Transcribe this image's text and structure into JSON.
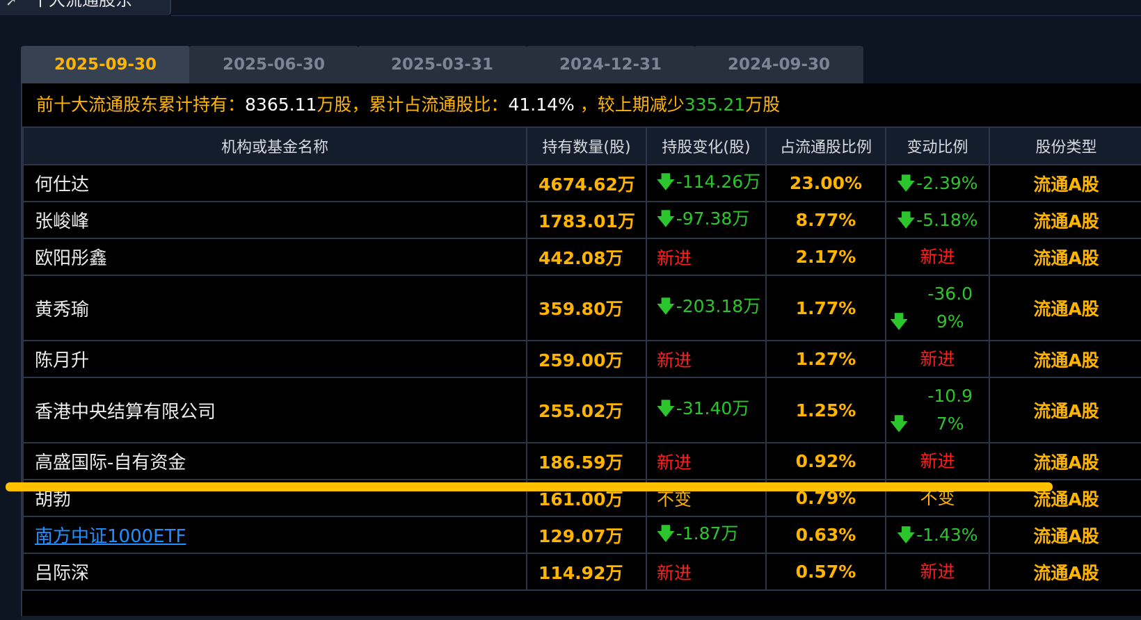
{
  "section": {
    "title": "十大流通股东"
  },
  "tabs": [
    {
      "label": "2025-09-30",
      "active": true
    },
    {
      "label": "2025-06-30",
      "active": false
    },
    {
      "label": "2025-03-31",
      "active": false
    },
    {
      "label": "2024-12-31",
      "active": false
    },
    {
      "label": "2024-09-30",
      "active": false
    }
  ],
  "summary": {
    "label1": "前十大流通股东累计持有：",
    "total": "8365.11",
    "unit1": "万股",
    "label2": "，累计占流通股比：",
    "ratio": "41.14%",
    "label3": " ，较上期减少",
    "change": "335.21",
    "unit2": "万股"
  },
  "table": {
    "headers": [
      "机构或基金名称",
      "持有数量(股)",
      "持股变化(股)",
      "占流通股比例",
      "变动比例",
      "股份类型"
    ],
    "rows": [
      {
        "name": "何仕达",
        "hold": "4674.62万",
        "change": "-114.26万",
        "ratio": "23.00%",
        "pct": "-2.39%",
        "type": "流通A股"
      },
      {
        "name": "张峻峰",
        "hold": "1783.01万",
        "change": "-97.38万",
        "ratio": "8.77%",
        "pct": "-5.18%",
        "type": "流通A股"
      },
      {
        "name": "欧阳彤鑫",
        "hold": "442.08万",
        "change": "新进",
        "ratio": "2.17%",
        "pct": "新进",
        "type": "流通A股"
      },
      {
        "name": "黄秀瑜",
        "hold": "359.80万",
        "change": "-203.18万",
        "ratio": "1.77%",
        "pct": "-36.09%",
        "type": "流通A股"
      },
      {
        "name": "陈月升",
        "hold": "259.00万",
        "change": "新进",
        "ratio": "1.27%",
        "pct": "新进",
        "type": "流通A股"
      },
      {
        "name": "香港中央结算有限公司",
        "hold": "255.02万",
        "change": "-31.40万",
        "ratio": "1.25%",
        "pct": "-10.97%",
        "type": "流通A股"
      },
      {
        "name": "高盛国际-自有资金",
        "hold": "186.59万",
        "change": "新进",
        "ratio": "0.92%",
        "pct": "新进",
        "type": "流通A股"
      },
      {
        "name": "胡勃",
        "hold": "161.00万",
        "change": "不变",
        "ratio": "0.79%",
        "pct": "不变",
        "type": "流通A股"
      },
      {
        "name": "南方中证1000ETF",
        "hold": "129.07万",
        "change": "-1.87万",
        "ratio": "0.63%",
        "pct": "-1.43%",
        "type": "流通A股"
      },
      {
        "name": "吕际深",
        "hold": "114.92万",
        "change": "新进",
        "ratio": "0.57%",
        "pct": "新进",
        "type": "流通A股"
      }
    ]
  },
  "icons": {
    "down": "arrow-down-icon",
    "header": "chevron-icon"
  },
  "colors": {
    "accent": "#ffb400",
    "down": "#2dc52d",
    "new": "#ff1e1e",
    "link": "#1e90ff",
    "highlight": "#ffc000"
  }
}
